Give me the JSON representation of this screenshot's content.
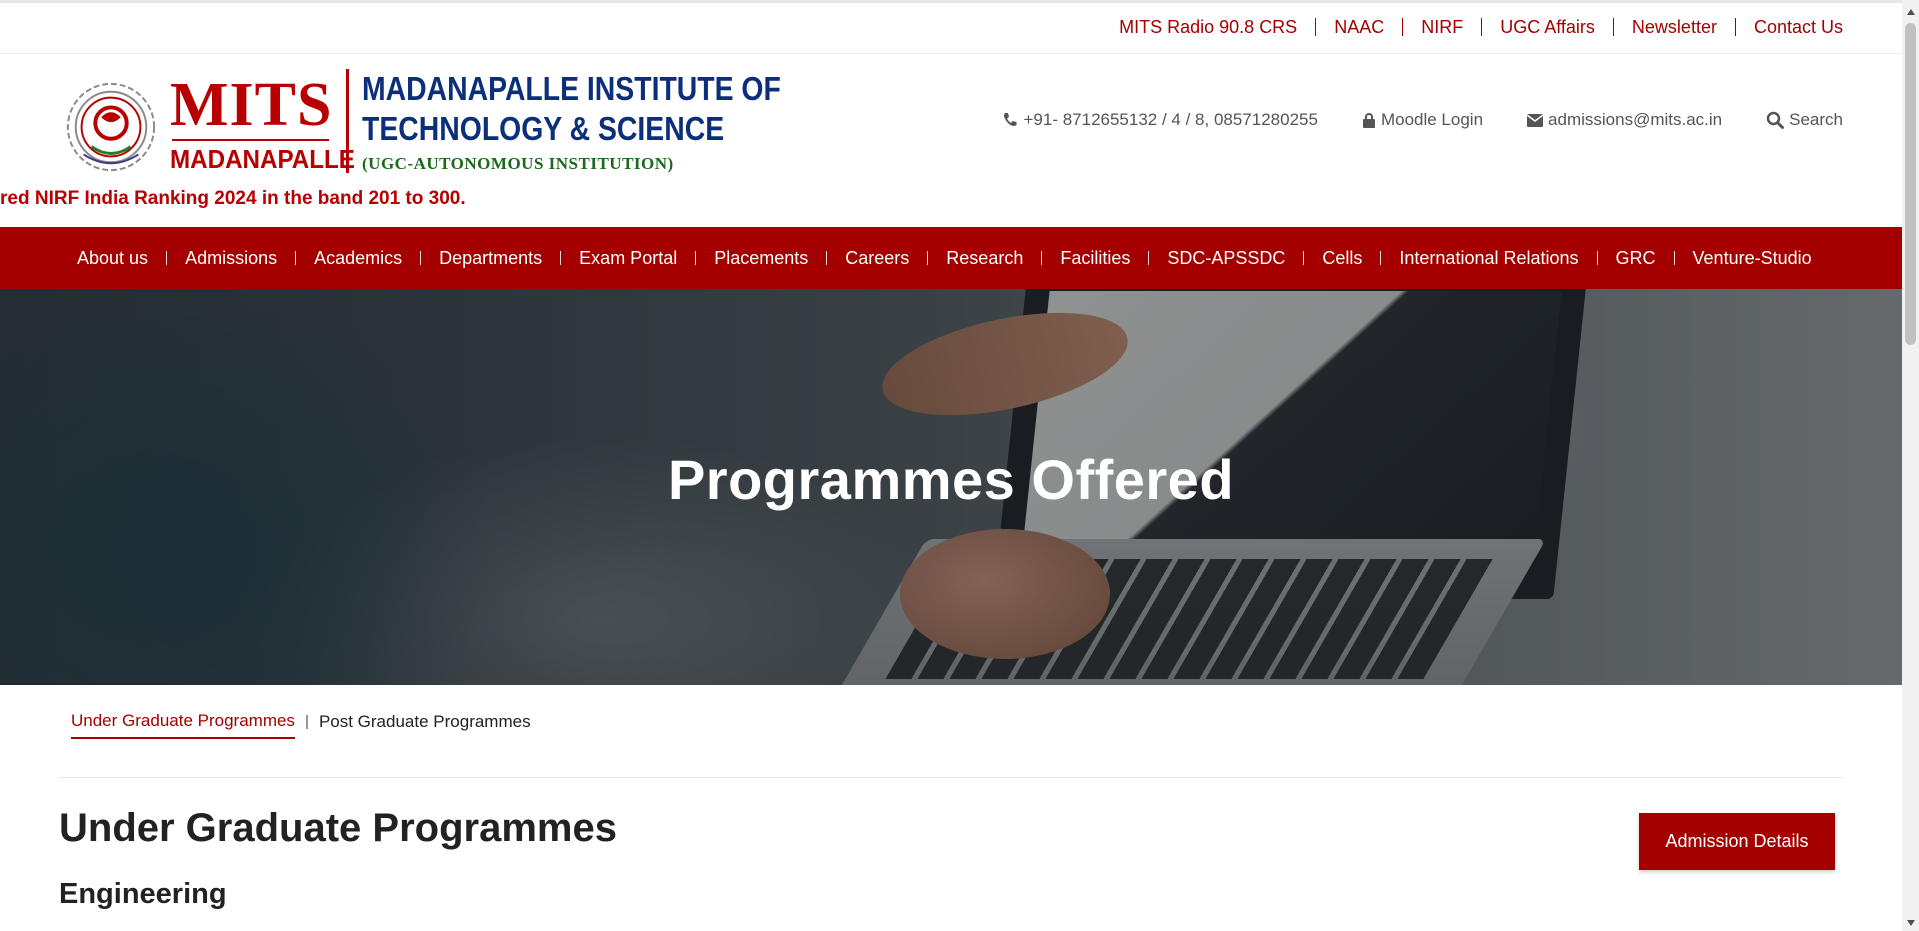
{
  "top_links": [
    "MITS Radio 90.8 CRS",
    "NAAC",
    "NIRF",
    "UGC Affairs",
    "Newsletter",
    "Contact Us"
  ],
  "logo": {
    "mits": "MITS",
    "city": "MADANAPALLE",
    "name_line1": "MADANAPALLE INSTITUTE OF",
    "name_line2": "TECHNOLOGY & SCIENCE",
    "subtitle": "(UGC-AUTONOMOUS INSTITUTION)"
  },
  "contacts": {
    "phone": "+91- 8712655132 / 4 / 8, 08571280255",
    "moodle": "Moodle Login",
    "email": "admissions@mits.ac.in",
    "search": "Search"
  },
  "ticker_text": "red NIRF India Ranking 2024 in the band 201 to 300.",
  "nav_items": [
    "About us",
    "Admissions",
    "Academics",
    "Departments",
    "Exam Portal",
    "Placements",
    "Careers",
    "Research",
    "Facilities",
    "SDC-APSSDC",
    "Cells",
    "International Relations",
    "GRC",
    "Venture-Studio"
  ],
  "hero": {
    "title": "Programmes Offered"
  },
  "tabs": {
    "active": "Under Graduate Programmes",
    "inactive": "Post Graduate Programmes"
  },
  "main": {
    "title": "Under Graduate Programmes",
    "subtitle": "Engineering",
    "admission_button": "Admission Details"
  },
  "colors": {
    "brand_red": "#a50000",
    "logo_blue": "#0b2f7a",
    "logo_green": "#1a6a1a"
  },
  "icons": [
    "phone-icon",
    "lock-icon",
    "envelope-icon",
    "search-icon",
    "scroll-up-arrow-icon",
    "scroll-down-arrow-icon"
  ]
}
